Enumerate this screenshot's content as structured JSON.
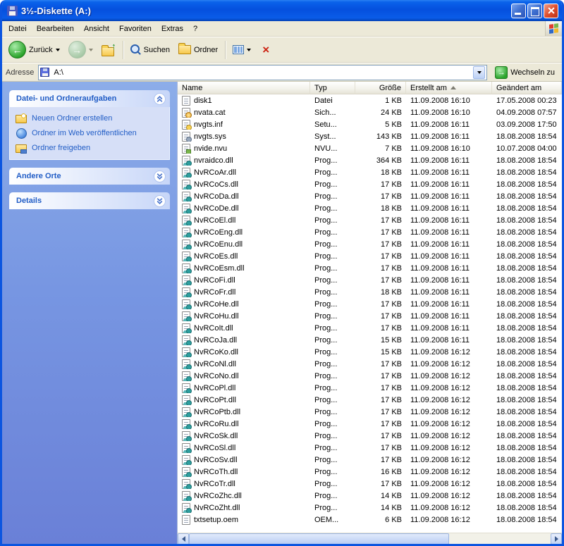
{
  "window": {
    "title": "3½-Diskette (A:)"
  },
  "menu": {
    "items": [
      "Datei",
      "Bearbeiten",
      "Ansicht",
      "Favoriten",
      "Extras",
      "?"
    ]
  },
  "toolbar": {
    "back_label": "Zurück",
    "search_label": "Suchen",
    "folders_label": "Ordner"
  },
  "addressbar": {
    "label": "Adresse",
    "value": "A:\\",
    "go_label": "Wechseln zu"
  },
  "sidebar": {
    "panels": [
      {
        "title": "Datei- und Ordneraufgaben",
        "expanded": true,
        "items": [
          {
            "label": "Neuen Ordner erstellen",
            "icon": "new-folder-icon"
          },
          {
            "label": "Ordner im Web veröffentlichen",
            "icon": "publish-web-icon"
          },
          {
            "label": "Ordner freigeben",
            "icon": "share-folder-icon"
          }
        ]
      },
      {
        "title": "Andere Orte",
        "expanded": false,
        "items": []
      },
      {
        "title": "Details",
        "expanded": false,
        "items": []
      }
    ]
  },
  "filelist": {
    "columns": [
      "Name",
      "Typ",
      "Größe",
      "Erstellt am",
      "Geändert am"
    ],
    "sort_column_index": 3,
    "sort_direction": "asc",
    "rows": [
      {
        "name": "disk1",
        "type": "Datei",
        "size": "1 KB",
        "created": "11.09.2008 16:10",
        "modified": "17.05.2008 00:23",
        "icon": "generic-file-icon"
      },
      {
        "name": "nvata.cat",
        "type": "Sich...",
        "size": "24 KB",
        "created": "11.09.2008 16:10",
        "modified": "04.09.2008 07:57",
        "icon": "cat-file-icon"
      },
      {
        "name": "nvgts.inf",
        "type": "Setu...",
        "size": "5 KB",
        "created": "11.09.2008 16:11",
        "modified": "03.09.2008 17:50",
        "icon": "inf-file-icon"
      },
      {
        "name": "nvgts.sys",
        "type": "Syst...",
        "size": "143 KB",
        "created": "11.09.2008 16:11",
        "modified": "18.08.2008 18:54",
        "icon": "sys-file-icon"
      },
      {
        "name": "nvide.nvu",
        "type": "NVU...",
        "size": "7 KB",
        "created": "11.09.2008 16:10",
        "modified": "10.07.2008 04:00",
        "icon": "nvu-file-icon"
      },
      {
        "name": "nvraidco.dll",
        "type": "Prog...",
        "size": "364 KB",
        "created": "11.09.2008 16:11",
        "modified": "18.08.2008 18:54",
        "icon": "dll-file-icon"
      },
      {
        "name": "NvRCoAr.dll",
        "type": "Prog...",
        "size": "18 KB",
        "created": "11.09.2008 16:11",
        "modified": "18.08.2008 18:54",
        "icon": "dll-file-icon"
      },
      {
        "name": "NvRCoCs.dll",
        "type": "Prog...",
        "size": "17 KB",
        "created": "11.09.2008 16:11",
        "modified": "18.08.2008 18:54",
        "icon": "dll-file-icon"
      },
      {
        "name": "NvRCoDa.dll",
        "type": "Prog...",
        "size": "17 KB",
        "created": "11.09.2008 16:11",
        "modified": "18.08.2008 18:54",
        "icon": "dll-file-icon"
      },
      {
        "name": "NvRCoDe.dll",
        "type": "Prog...",
        "size": "18 KB",
        "created": "11.09.2008 16:11",
        "modified": "18.08.2008 18:54",
        "icon": "dll-file-icon"
      },
      {
        "name": "NvRCoEl.dll",
        "type": "Prog...",
        "size": "17 KB",
        "created": "11.09.2008 16:11",
        "modified": "18.08.2008 18:54",
        "icon": "dll-file-icon"
      },
      {
        "name": "NvRCoEng.dll",
        "type": "Prog...",
        "size": "17 KB",
        "created": "11.09.2008 16:11",
        "modified": "18.08.2008 18:54",
        "icon": "dll-file-icon"
      },
      {
        "name": "NvRCoEnu.dll",
        "type": "Prog...",
        "size": "17 KB",
        "created": "11.09.2008 16:11",
        "modified": "18.08.2008 18:54",
        "icon": "dll-file-icon"
      },
      {
        "name": "NvRCoEs.dll",
        "type": "Prog...",
        "size": "17 KB",
        "created": "11.09.2008 16:11",
        "modified": "18.08.2008 18:54",
        "icon": "dll-file-icon"
      },
      {
        "name": "NvRCoEsm.dll",
        "type": "Prog...",
        "size": "17 KB",
        "created": "11.09.2008 16:11",
        "modified": "18.08.2008 18:54",
        "icon": "dll-file-icon"
      },
      {
        "name": "NvRCoFi.dll",
        "type": "Prog...",
        "size": "17 KB",
        "created": "11.09.2008 16:11",
        "modified": "18.08.2008 18:54",
        "icon": "dll-file-icon"
      },
      {
        "name": "NvRCoFr.dll",
        "type": "Prog...",
        "size": "18 KB",
        "created": "11.09.2008 16:11",
        "modified": "18.08.2008 18:54",
        "icon": "dll-file-icon"
      },
      {
        "name": "NvRCoHe.dll",
        "type": "Prog...",
        "size": "17 KB",
        "created": "11.09.2008 16:11",
        "modified": "18.08.2008 18:54",
        "icon": "dll-file-icon"
      },
      {
        "name": "NvRCoHu.dll",
        "type": "Prog...",
        "size": "17 KB",
        "created": "11.09.2008 16:11",
        "modified": "18.08.2008 18:54",
        "icon": "dll-file-icon"
      },
      {
        "name": "NvRCoIt.dll",
        "type": "Prog...",
        "size": "17 KB",
        "created": "11.09.2008 16:11",
        "modified": "18.08.2008 18:54",
        "icon": "dll-file-icon"
      },
      {
        "name": "NvRCoJa.dll",
        "type": "Prog...",
        "size": "15 KB",
        "created": "11.09.2008 16:11",
        "modified": "18.08.2008 18:54",
        "icon": "dll-file-icon"
      },
      {
        "name": "NvRCoKo.dll",
        "type": "Prog...",
        "size": "15 KB",
        "created": "11.09.2008 16:12",
        "modified": "18.08.2008 18:54",
        "icon": "dll-file-icon"
      },
      {
        "name": "NvRCoNl.dll",
        "type": "Prog...",
        "size": "17 KB",
        "created": "11.09.2008 16:12",
        "modified": "18.08.2008 18:54",
        "icon": "dll-file-icon"
      },
      {
        "name": "NvRCoNo.dll",
        "type": "Prog...",
        "size": "17 KB",
        "created": "11.09.2008 16:12",
        "modified": "18.08.2008 18:54",
        "icon": "dll-file-icon"
      },
      {
        "name": "NvRCoPl.dll",
        "type": "Prog...",
        "size": "17 KB",
        "created": "11.09.2008 16:12",
        "modified": "18.08.2008 18:54",
        "icon": "dll-file-icon"
      },
      {
        "name": "NvRCoPt.dll",
        "type": "Prog...",
        "size": "17 KB",
        "created": "11.09.2008 16:12",
        "modified": "18.08.2008 18:54",
        "icon": "dll-file-icon"
      },
      {
        "name": "NvRCoPtb.dll",
        "type": "Prog...",
        "size": "17 KB",
        "created": "11.09.2008 16:12",
        "modified": "18.08.2008 18:54",
        "icon": "dll-file-icon"
      },
      {
        "name": "NvRCoRu.dll",
        "type": "Prog...",
        "size": "17 KB",
        "created": "11.09.2008 16:12",
        "modified": "18.08.2008 18:54",
        "icon": "dll-file-icon"
      },
      {
        "name": "NvRCoSk.dll",
        "type": "Prog...",
        "size": "17 KB",
        "created": "11.09.2008 16:12",
        "modified": "18.08.2008 18:54",
        "icon": "dll-file-icon"
      },
      {
        "name": "NvRCoSl.dll",
        "type": "Prog...",
        "size": "17 KB",
        "created": "11.09.2008 16:12",
        "modified": "18.08.2008 18:54",
        "icon": "dll-file-icon"
      },
      {
        "name": "NvRCoSv.dll",
        "type": "Prog...",
        "size": "17 KB",
        "created": "11.09.2008 16:12",
        "modified": "18.08.2008 18:54",
        "icon": "dll-file-icon"
      },
      {
        "name": "NvRCoTh.dll",
        "type": "Prog...",
        "size": "16 KB",
        "created": "11.09.2008 16:12",
        "modified": "18.08.2008 18:54",
        "icon": "dll-file-icon"
      },
      {
        "name": "NvRCoTr.dll",
        "type": "Prog...",
        "size": "17 KB",
        "created": "11.09.2008 16:12",
        "modified": "18.08.2008 18:54",
        "icon": "dll-file-icon"
      },
      {
        "name": "NvRCoZhc.dll",
        "type": "Prog...",
        "size": "14 KB",
        "created": "11.09.2008 16:12",
        "modified": "18.08.2008 18:54",
        "icon": "dll-file-icon"
      },
      {
        "name": "NvRCoZht.dll",
        "type": "Prog...",
        "size": "14 KB",
        "created": "11.09.2008 16:12",
        "modified": "18.08.2008 18:54",
        "icon": "dll-file-icon"
      },
      {
        "name": "txtsetup.oem",
        "type": "OEM...",
        "size": "6 KB",
        "created": "11.09.2008 16:12",
        "modified": "18.08.2008 18:54",
        "icon": "generic-file-icon"
      }
    ]
  }
}
